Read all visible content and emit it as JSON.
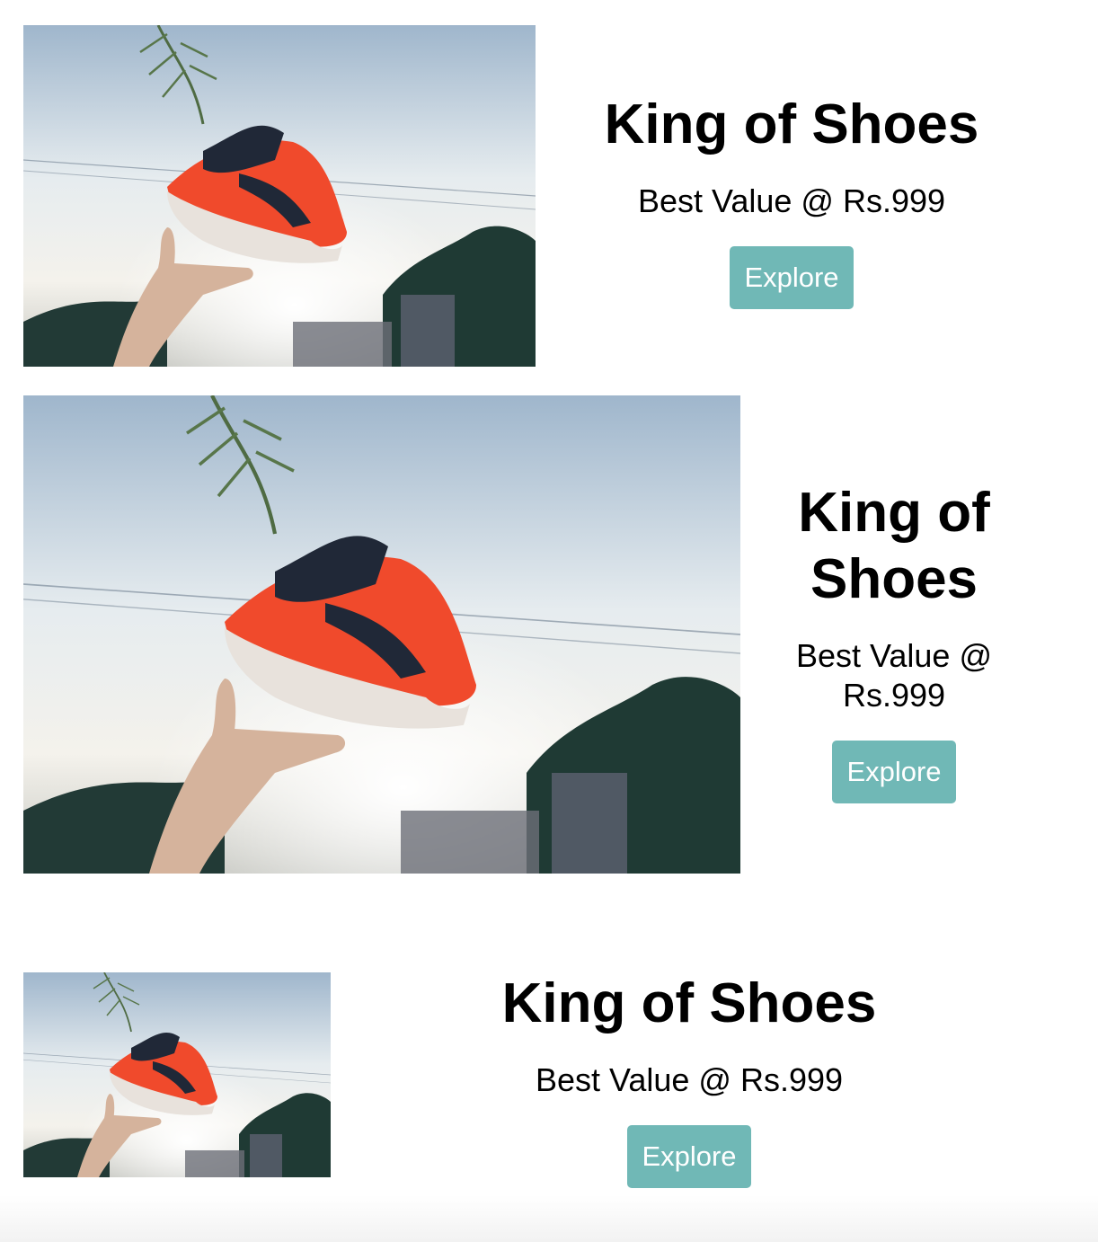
{
  "cards": [
    {
      "title": "King of Shoes",
      "subtitle": "Best Value @ Rs.999",
      "button_label": "Explore"
    },
    {
      "title": "King of Shoes",
      "subtitle": "Best Value @ Rs.999",
      "button_label": "Explore"
    },
    {
      "title": "King of Shoes",
      "subtitle": "Best Value @ Rs.999",
      "button_label": "Explore"
    }
  ],
  "colors": {
    "button_background": "#70b8b6",
    "button_text": "#ffffff",
    "page_background": "#ffffff"
  },
  "photo": {
    "subject": "red-sneaker-floating-above-hand"
  }
}
